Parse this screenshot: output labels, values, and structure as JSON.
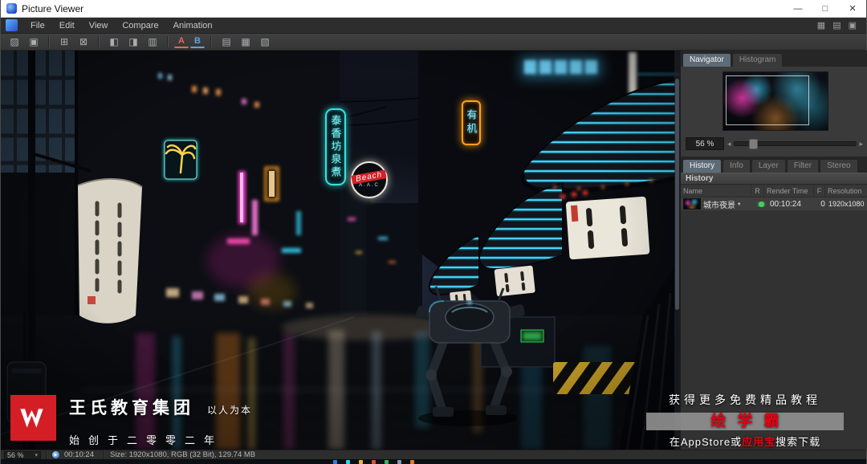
{
  "titlebar": {
    "title": "Picture Viewer",
    "minimize": "—",
    "maximize": "□",
    "close": "✕"
  },
  "menubar": {
    "items": [
      "File",
      "Edit",
      "View",
      "Compare",
      "Animation"
    ],
    "right_icons": [
      "▦",
      "▤",
      "▣"
    ]
  },
  "toolbar": {
    "icons": [
      "▨",
      "▣",
      "⊞",
      "⊠",
      "◧",
      "◨",
      "▥",
      "A",
      "B",
      "▤",
      "▦",
      "▧"
    ]
  },
  "navigator": {
    "tabs": [
      "Navigator",
      "Histogram"
    ],
    "zoom": "56 %",
    "slider_left": "◂",
    "slider_right": "▸"
  },
  "history": {
    "tabs": [
      "History",
      "Info",
      "Layer",
      "Filter",
      "Stereo"
    ],
    "header": "History",
    "columns": [
      "Name",
      "R",
      "Render Time",
      "F",
      "Resolution"
    ],
    "row": {
      "name": "城市夜景 *",
      "render_time": "00:10:24",
      "frame": "0",
      "resolution": "1920x1080",
      "status_color": "#43d15c"
    }
  },
  "statusbar": {
    "zoom": "56 %",
    "caret": "▾",
    "play": "▶",
    "time": "00:10:24",
    "info": "Size: 1920x1080, RGB (32 Bit), 129.74 MB"
  },
  "scene": {
    "sign_tea": "泰香坊泉煮",
    "sign_beach": "Beach",
    "sign_beach_sub": "A.A.C",
    "sign_organic": "有机"
  },
  "watermark": {
    "brand": "王氏教育集团",
    "slogan": "以人为本",
    "since": "始创于二零零二年",
    "promo": "获得更多免费精品教程",
    "app_name": "绘学霸",
    "download_prefix": "在AppStore或",
    "download_app": "应用宝",
    "download_suffix": "搜索下载"
  },
  "colors": {
    "brand_red": "#d41e26",
    "promo_red": "#e60012",
    "neon_cyan": "#3ae0e0",
    "neon_pink": "#ff3dd0",
    "neon_orange": "#ff9c1a",
    "status_green": "#43d15c",
    "active_tab": "#5d6b77"
  }
}
